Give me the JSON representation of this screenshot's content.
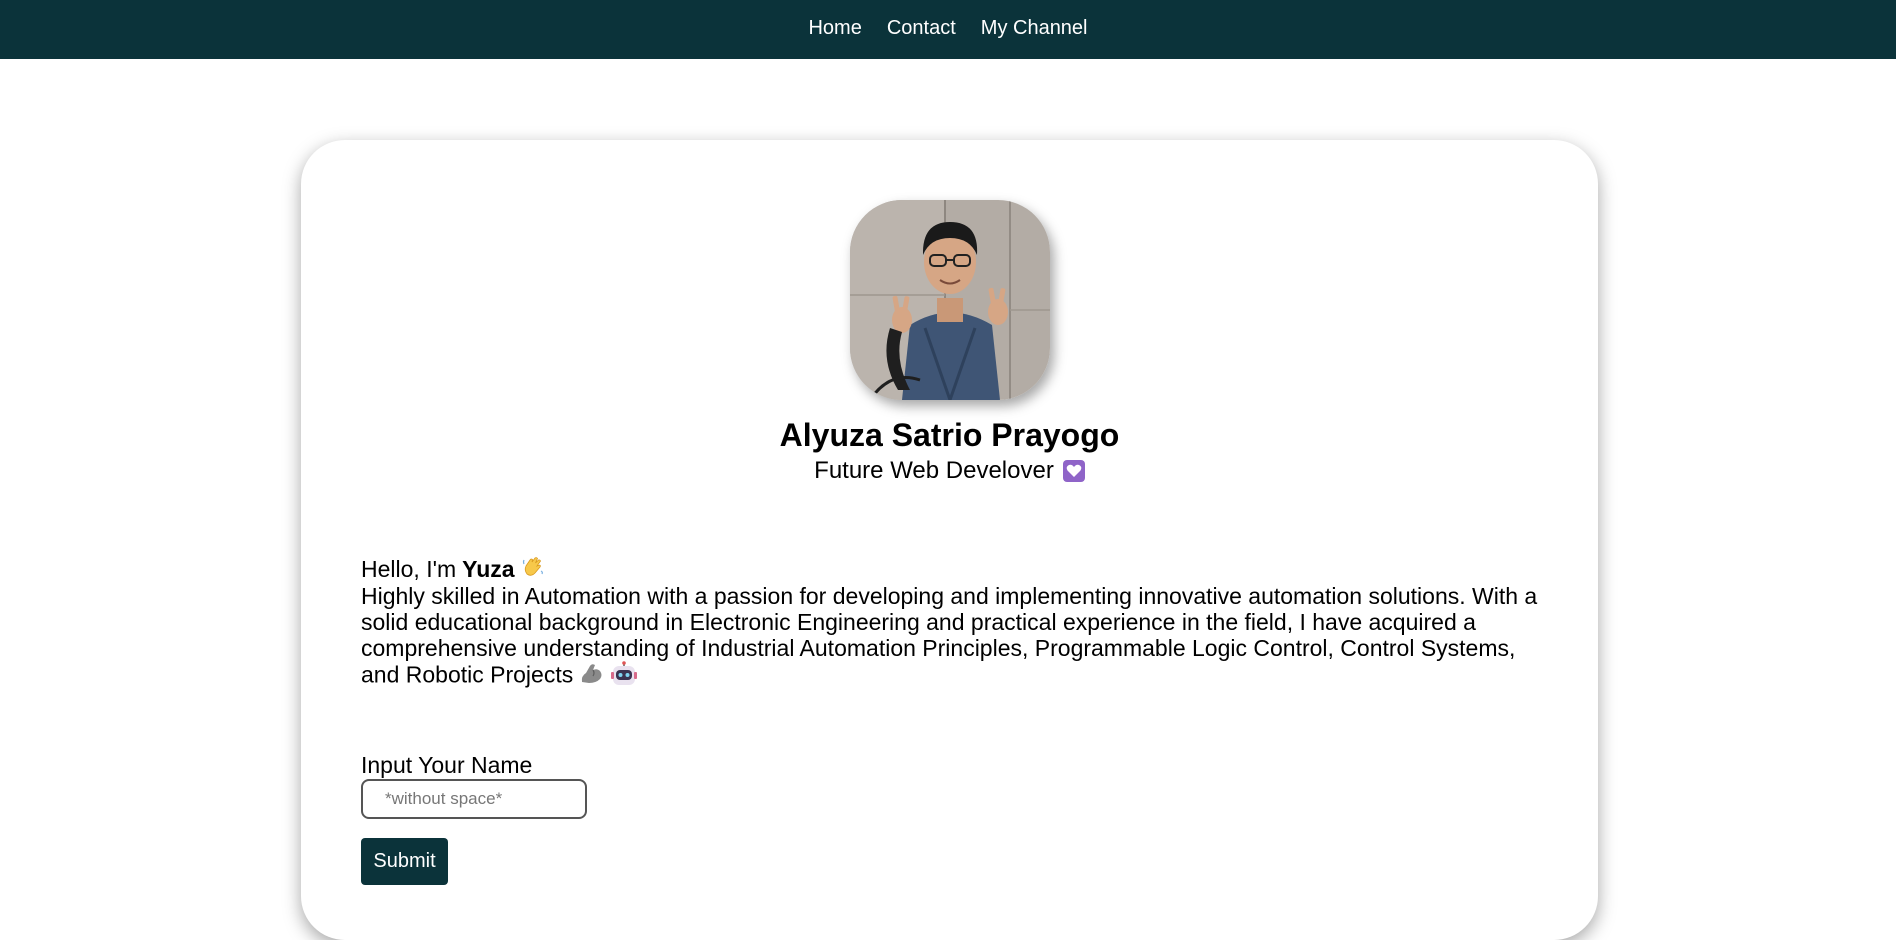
{
  "nav": {
    "items": [
      {
        "label": "Home"
      },
      {
        "label": "Contact"
      },
      {
        "label": "My Channel"
      }
    ]
  },
  "profile": {
    "name": "Alyuza Satrio Prayogo",
    "role": "Future Web Develover",
    "role_icon": "heart-icon"
  },
  "about": {
    "greeting_prefix": "Hello, I'm",
    "greeting_name": "Yuza",
    "greeting_icon": "waving-hand-icon",
    "bio": "Highly skilled in Automation with a passion for developing and implementing innovative automation solutions. With a solid educational background in Electronic Engineering and practical experience in the field, I have acquired a comprehensive understanding of Industrial Automation Principles, Programmable Logic Control, Control Systems, and Robotic Projects",
    "bio_icons": [
      "flexed-arm-icon",
      "robot-icon"
    ]
  },
  "form": {
    "label": "Input Your Name",
    "input_value": "",
    "input_placeholder": "*without space*",
    "submit_label": "Submit"
  },
  "colors": {
    "navbar_bg": "#0b333a",
    "button_bg": "#0b333a",
    "heart_box": "#8f64c8"
  }
}
